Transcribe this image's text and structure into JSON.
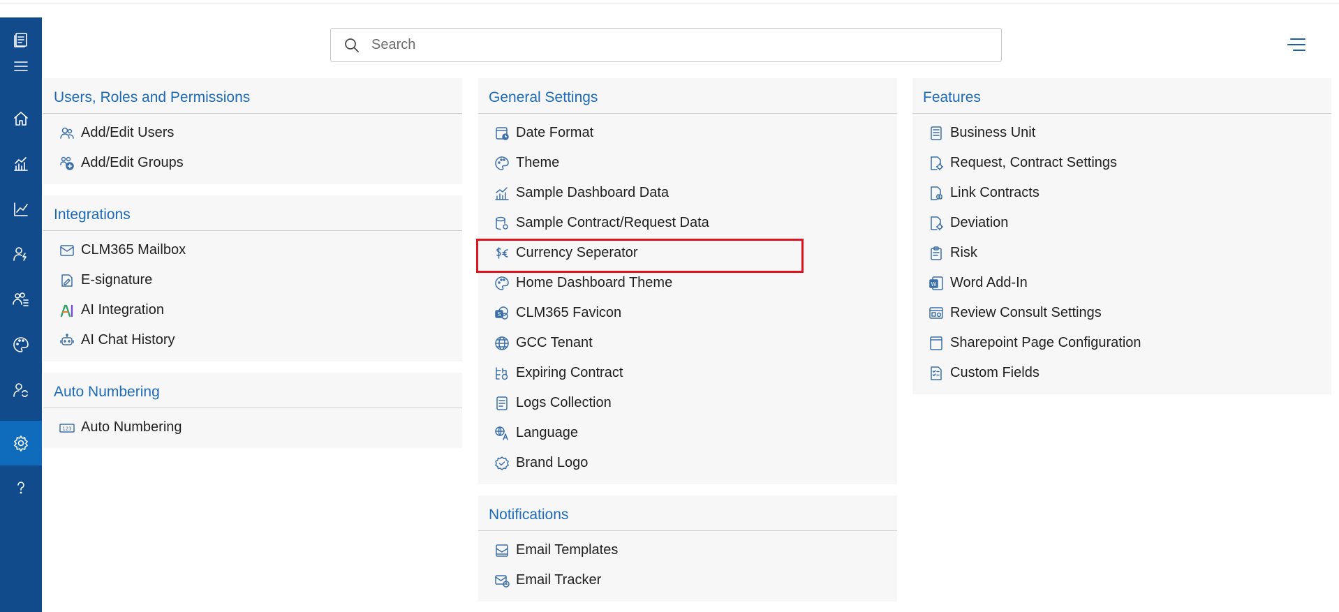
{
  "search": {
    "placeholder": "Search"
  },
  "sidebar": {
    "items": [
      {
        "name": "app-logo-icon"
      },
      {
        "name": "hamburger-menu-icon"
      },
      {
        "name": "home-icon"
      },
      {
        "name": "dashboard-chart-icon"
      },
      {
        "name": "trend-line-icon"
      },
      {
        "name": "user-flash-icon"
      },
      {
        "name": "team-list-icon"
      },
      {
        "name": "palette-icon"
      },
      {
        "name": "user-sync-icon"
      },
      {
        "name": "settings-gear-icon",
        "active": true
      },
      {
        "name": "help-icon"
      }
    ]
  },
  "panels": {
    "users": {
      "title": "Users, Roles and Permissions",
      "items": [
        {
          "label": "Add/Edit Users",
          "icon": "users-icon"
        },
        {
          "label": "Add/Edit Groups",
          "icon": "groups-add-icon"
        }
      ]
    },
    "integrations": {
      "title": "Integrations",
      "items": [
        {
          "label": "CLM365 Mailbox",
          "icon": "mail-icon"
        },
        {
          "label": "E-signature",
          "icon": "signature-icon"
        },
        {
          "label": "AI Integration",
          "icon": "ai-icon"
        },
        {
          "label": "AI Chat History",
          "icon": "bot-icon"
        }
      ]
    },
    "auto_numbering": {
      "title": "Auto Numbering",
      "items": [
        {
          "label": "Auto Numbering",
          "icon": "number-123-icon"
        }
      ]
    },
    "general": {
      "title": "General Settings",
      "items": [
        {
          "label": "Date Format",
          "icon": "calendar-clock-icon"
        },
        {
          "label": "Theme",
          "icon": "palette-icon"
        },
        {
          "label": "Sample Dashboard Data",
          "icon": "bar-chart-icon"
        },
        {
          "label": "Sample Contract/Request Data",
          "icon": "database-gear-icon"
        },
        {
          "label": "Currency Seperator",
          "icon": "currency-icon"
        },
        {
          "label": "Home Dashboard Theme",
          "icon": "palette-icon"
        },
        {
          "label": "CLM365 Favicon",
          "icon": "sharepoint-icon"
        },
        {
          "label": "GCC Tenant",
          "icon": "globe-icon"
        },
        {
          "label": "Expiring Contract",
          "icon": "timeline-icon"
        },
        {
          "label": "Logs Collection",
          "icon": "log-document-icon"
        },
        {
          "label": "Language",
          "icon": "translate-icon"
        },
        {
          "label": "Brand Logo",
          "icon": "badge-check-icon"
        }
      ]
    },
    "notifications": {
      "title": "Notifications",
      "items": [
        {
          "label": "Email Templates",
          "icon": "email-template-icon"
        },
        {
          "label": "Email Tracker",
          "icon": "email-clock-icon"
        }
      ]
    },
    "features": {
      "title": "Features",
      "items": [
        {
          "label": "Business Unit",
          "icon": "document-list-icon"
        },
        {
          "label": "Request, Contract Settings",
          "icon": "document-gear-icon"
        },
        {
          "label": "Link Contracts",
          "icon": "document-link-icon"
        },
        {
          "label": "Deviation",
          "icon": "document-gear-icon"
        },
        {
          "label": "Risk",
          "icon": "clipboard-icon"
        },
        {
          "label": "Word Add-In",
          "icon": "word-icon"
        },
        {
          "label": "Review Consult Settings",
          "icon": "window-settings-icon"
        },
        {
          "label": "Sharepoint Page Configuration",
          "icon": "page-icon"
        },
        {
          "label": "Custom Fields",
          "icon": "checklist-icon"
        }
      ]
    }
  },
  "colors": {
    "sidebar": "#114b8c",
    "sidebar_active": "#0f6cbd",
    "panel_title": "#1c6ab8",
    "highlight": "#e0141e"
  }
}
